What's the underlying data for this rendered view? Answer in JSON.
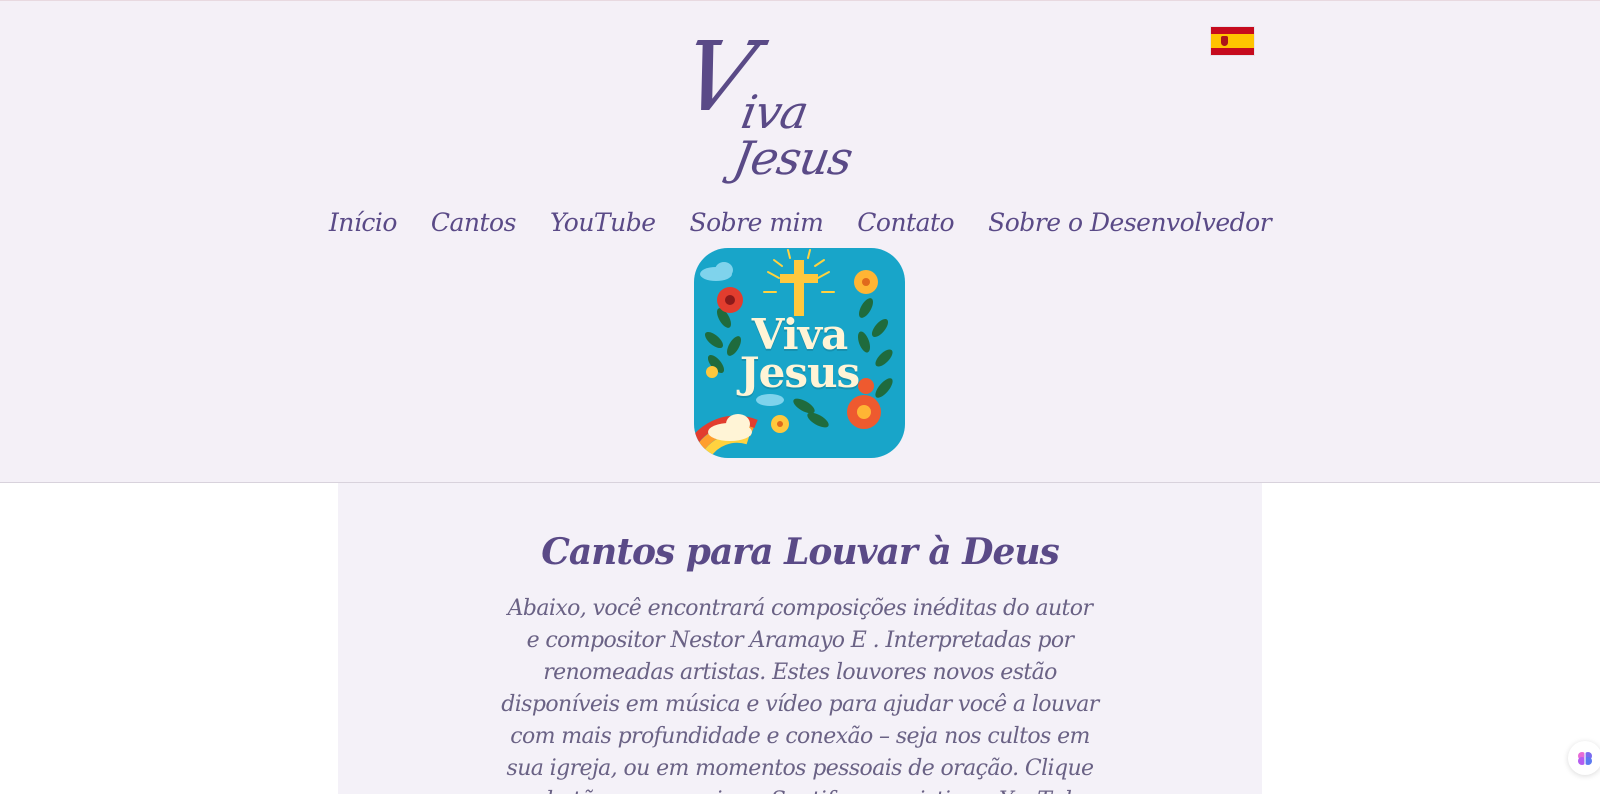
{
  "header": {
    "logo_first": "V",
    "logo_rest": "iva Jesus",
    "language_flag": "spain-flag-icon",
    "nav": [
      {
        "label": "Início"
      },
      {
        "label": "Cantos"
      },
      {
        "label": "YouTube"
      },
      {
        "label": "Sobre mim"
      },
      {
        "label": "Contato"
      },
      {
        "label": "Sobre o Desenvolvedor"
      }
    ],
    "app_icon": {
      "line1": "Viva",
      "line2": "Jesus"
    }
  },
  "main": {
    "title": "Cantos para Louvar à Deus",
    "description": "Abaixo, você encontrará composições inéditas do autor e compositor Nestor Aramayo E . Interpretadas por renomeadas artistas. Estes louvores novos estão disponíveis em música e vídeo para ajudar você a louvar com mais profundidade e conexão – seja nos cultos em sua igreja, ou em momentos pessoais de oração. Clique nos botões para ouvir no Spotify ou assistir no YouTube."
  },
  "colors": {
    "brand": "#5a4a87",
    "header_bg": "#f4f0f7",
    "main_bg": "#f4f1f8",
    "icon_bg": "#18a5c9"
  },
  "floating_widget": "brain-icon"
}
